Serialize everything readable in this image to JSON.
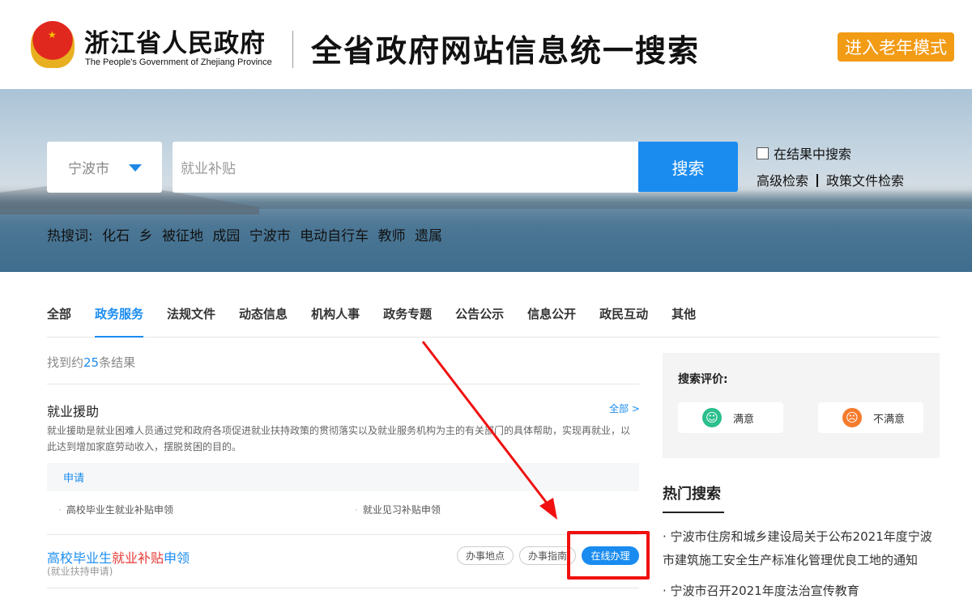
{
  "header": {
    "brand": "浙江省人民政府",
    "brand_en": "The People's Government of Zhejiang Province",
    "site_title": "全省政府网站信息统一搜索",
    "elder_mode": "进入老年模式"
  },
  "search": {
    "city": "宁波市",
    "query": "就业补贴",
    "button": "搜索",
    "in_result": "在结果中搜索",
    "advanced": "高级检索",
    "policy": "政策文件检索"
  },
  "hot_words": {
    "label": "热搜词:",
    "items": [
      "化石",
      "乡",
      "被征地",
      "成园",
      "宁波市",
      "电动自行车",
      "教师",
      "遗属"
    ]
  },
  "tabs": [
    "全部",
    "政务服务",
    "法规文件",
    "动态信息",
    "机构人事",
    "政务专题",
    "公告公示",
    "信息公开",
    "政民互动",
    "其他"
  ],
  "results": {
    "count_prefix": "找到约",
    "count": "25",
    "count_suffix": "条结果",
    "category": {
      "title": "就业援助",
      "all": "全部 >",
      "desc": "就业援助是就业困难人员通过党和政府各项促进就业扶持政策的贯彻落实以及就业服务机构为主的有关部门的具体帮助，实现再就业，以此达到增加家庭劳动收入，摆脱贫困的目的。",
      "group": "申请",
      "items": [
        "高校毕业生就业补贴申领",
        "就业见习补贴申领"
      ]
    },
    "item": {
      "title_a": "高校毕业生",
      "title_hl": "就业补贴",
      "title_b": "申领",
      "sub": "(就业扶持申请)",
      "btn_place": "办事地点",
      "btn_guide": "办事指南",
      "btn_online": "在线办理"
    }
  },
  "evaluation": {
    "title": "搜索评价:",
    "satisfied": "满意",
    "unsatisfied": "不满意"
  },
  "hot_search": {
    "title": "热门搜索",
    "items": [
      "宁波市住房和城乡建设局关于公布2021年度宁波市建筑施工安全生产标准化管理优良工地的通知",
      "宁波市召开2021年度法治宣传教育"
    ]
  },
  "colors": {
    "accent": "#1a8cf0",
    "highlight": "#e53935",
    "elder": "#f29b14",
    "annotation": "#f01010"
  }
}
